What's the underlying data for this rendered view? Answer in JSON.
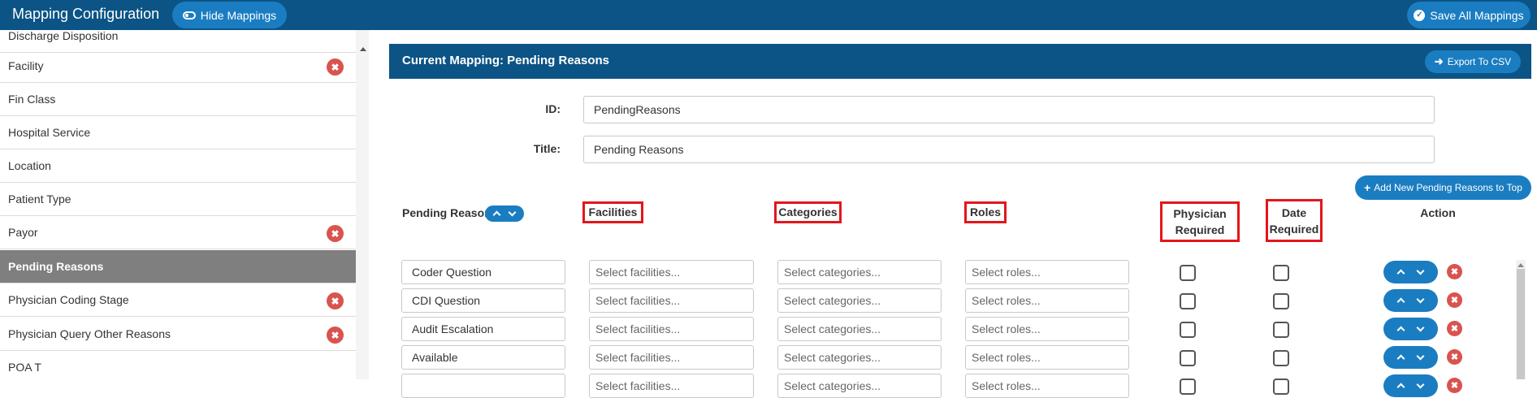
{
  "header": {
    "title": "Mapping Configuration",
    "hide_label": "Hide Mappings",
    "save_all_label": "Save All Mappings"
  },
  "sidebar": {
    "items": [
      {
        "label": "Discharge Disposition",
        "removable": false,
        "active": false
      },
      {
        "label": "Facility",
        "removable": true,
        "active": false
      },
      {
        "label": "Fin Class",
        "removable": false,
        "active": false
      },
      {
        "label": "Hospital Service",
        "removable": false,
        "active": false
      },
      {
        "label": "Location",
        "removable": false,
        "active": false
      },
      {
        "label": "Patient Type",
        "removable": false,
        "active": false
      },
      {
        "label": "Payor",
        "removable": true,
        "active": false
      },
      {
        "label": "Pending Reasons",
        "removable": false,
        "active": true
      },
      {
        "label": "Physician Coding Stage",
        "removable": true,
        "active": false
      },
      {
        "label": "Physician Query Other Reasons",
        "removable": true,
        "active": false
      },
      {
        "label": "POA T",
        "removable": false,
        "active": false
      }
    ]
  },
  "panel": {
    "title": "Current Mapping: Pending Reasons",
    "export_label": "Export To CSV",
    "id_label": "ID:",
    "id_value": "PendingReasons",
    "title_label": "Title:",
    "title_value": "Pending Reasons",
    "add_label": "Add New Pending Reasons to Top"
  },
  "columns": {
    "reason": "Pending Reason",
    "facilities": "Facilities",
    "categories": "Categories",
    "roles": "Roles",
    "physician_line1": "Physician",
    "physician_line2": "Required",
    "date_line1": "Date",
    "date_line2": "Required",
    "action": "Action"
  },
  "placeholders": {
    "facilities": "Select facilities...",
    "categories": "Select categories...",
    "roles": "Select roles..."
  },
  "rows": [
    {
      "reason": "Coder Question",
      "physician_required": false,
      "date_required": false
    },
    {
      "reason": "CDI Question",
      "physician_required": false,
      "date_required": false
    },
    {
      "reason": "Audit Escalation",
      "physician_required": false,
      "date_required": false
    },
    {
      "reason": "Available",
      "physician_required": false,
      "date_required": false
    },
    {
      "reason": "",
      "physician_required": false,
      "date_required": false
    }
  ],
  "colors": {
    "header_bg": "#0b5485",
    "button_bg": "#1b7dc1",
    "active_item_bg": "#7f7f7f",
    "remove_red": "#d9534f",
    "highlight_red": "#e3161b"
  },
  "icons": {
    "hide_toggle": "toggle-icon",
    "save": "check-circle-icon",
    "export": "arrow-right-icon",
    "add": "plus-icon",
    "remove": "close-circle-icon",
    "sort": "chevron-up-down-icon"
  }
}
